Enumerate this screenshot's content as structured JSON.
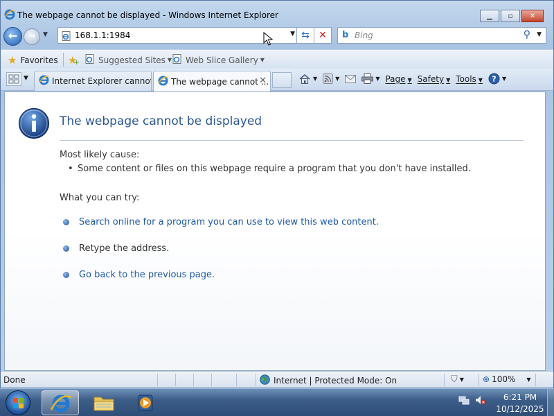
{
  "window": {
    "title": "The webpage cannot be displayed - Windows Internet Explorer"
  },
  "nav": {
    "address": "168.1.1:1984",
    "search_placeholder": "Bing"
  },
  "favorites": {
    "favorites_label": "Favorites",
    "suggested_sites": "Suggested Sites",
    "web_slice_gallery": "Web Slice Gallery"
  },
  "tabs": [
    {
      "label": "Internet Explorer cannot ...",
      "active": false
    },
    {
      "label": "The webpage cannot ...",
      "active": true
    }
  ],
  "command_bar": {
    "page": "Page",
    "safety": "Safety",
    "tools": "Tools"
  },
  "content": {
    "heading": "The webpage cannot be displayed",
    "cause_label": "Most likely cause:",
    "cause_items": [
      "Some content or files on this webpage require a program that you don't have installed."
    ],
    "try_label": "What you can try:",
    "try_items": [
      {
        "text": "Search online for a program you can use to view this web content.",
        "link": true
      },
      {
        "text": "Retype the address.",
        "link": false
      },
      {
        "text": "Go back to the previous page.",
        "link": true
      }
    ]
  },
  "status": {
    "left": "Done",
    "zone": "Internet | Protected Mode: On",
    "zoom": "100%"
  },
  "taskbar": {
    "time": "6:21 PM",
    "date": "10/12/2025"
  },
  "colors": {
    "link": "#1d5aa8",
    "heading": "#2b5796",
    "close_button": "#c7442c"
  }
}
